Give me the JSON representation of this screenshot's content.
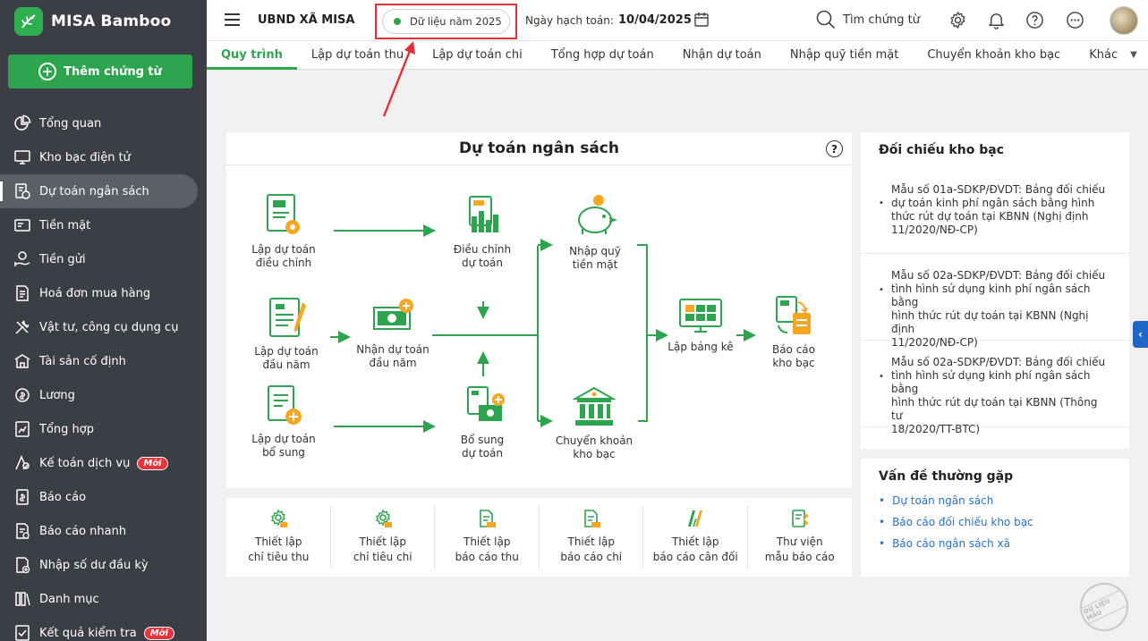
{
  "app": {
    "name": "MISA Bamboo"
  },
  "sidebar": {
    "add_button": "Thêm chứng từ",
    "items": [
      {
        "label": "Tổng quan",
        "icon": "pie-chart-icon"
      },
      {
        "label": "Kho bạc điện tử",
        "icon": "monitor-icon"
      },
      {
        "label": "Dự toán ngân sách",
        "icon": "budget-icon",
        "active": true
      },
      {
        "label": "Tiền mặt",
        "icon": "cash-icon"
      },
      {
        "label": "Tiền gửi",
        "icon": "deposit-icon"
      },
      {
        "label": "Hoá đơn mua hàng",
        "icon": "invoice-icon"
      },
      {
        "label": "Vật tư, công cụ dụng cụ",
        "icon": "tools-icon"
      },
      {
        "label": "Tài sản cố định",
        "icon": "asset-icon"
      },
      {
        "label": "Lương",
        "icon": "salary-icon"
      },
      {
        "label": "Tổng hợp",
        "icon": "summary-icon"
      },
      {
        "label": "Kế toán dịch vụ",
        "icon": "service-icon",
        "badge": "Mới"
      },
      {
        "label": "Báo cáo",
        "icon": "report-icon"
      },
      {
        "label": "Báo cáo nhanh",
        "icon": "quick-report-icon"
      },
      {
        "label": "Nhập số dư đầu kỳ",
        "icon": "opening-balance-icon"
      },
      {
        "label": "Danh mục",
        "icon": "catalog-icon"
      },
      {
        "label": "Kết quả kiểm tra",
        "icon": "check-result-icon",
        "badge": "Mới"
      }
    ]
  },
  "header": {
    "org": "UBND XÃ MISA",
    "year": "Dữ liệu năm 2025",
    "posting_label": "Ngày hạch toán:",
    "posting_date": "10/04/2025",
    "search": "Tìm chứng từ"
  },
  "tabs": [
    {
      "label": "Quy trình",
      "active": true
    },
    {
      "label": "Lập dự toán thu"
    },
    {
      "label": "Lập dự toán chi"
    },
    {
      "label": "Tổng hợp dự toán"
    },
    {
      "label": "Nhận dự toán"
    },
    {
      "label": "Nhập quỹ tiền mặt"
    },
    {
      "label": "Chuyển khoản kho bạc"
    },
    {
      "label": "Khác"
    }
  ],
  "flow": {
    "title": "Dự toán ngân sách",
    "nodes": {
      "adjust_create": [
        "Lập dự toán",
        "điều chỉnh"
      ],
      "adjust": [
        "Điều chỉnh",
        "dự toán"
      ],
      "cash_in": [
        "Nhập quỹ",
        "tiền mặt"
      ],
      "initial_create": [
        "Lập dự toán",
        "đầu năm"
      ],
      "initial_receive": [
        "Nhận dự toán",
        "đầu năm"
      ],
      "statement": [
        "Lập bảng kê"
      ],
      "treasury_report": [
        "Báo cáo",
        "kho bạc"
      ],
      "supplement_create": [
        "Lập dự toán",
        "bổ sung"
      ],
      "supplement": [
        "Bổ sung",
        "dự toán"
      ],
      "transfer": [
        "Chuyển khoản",
        "kho bạc"
      ]
    }
  },
  "tools": [
    [
      "Thiết lập",
      "chỉ tiêu thu"
    ],
    [
      "Thiết lập",
      "chỉ tiêu chi"
    ],
    [
      "Thiết lập",
      "báo cáo thu"
    ],
    [
      "Thiết lập",
      "báo cáo chi"
    ],
    [
      "Thiết lập",
      "báo cáo cân đối"
    ],
    [
      "Thư viện",
      "mẫu báo cáo"
    ]
  ],
  "recon": {
    "title": "Đối chiếu kho bạc",
    "items": [
      [
        "Mẫu số 01a-SDKP/ĐVDT: Bảng đối chiếu",
        "dự toán kinh phí ngân sách bằng hình",
        "thức rút dự toán tại KBNN (Nghị định",
        "11/2020/NĐ-CP)"
      ],
      [
        "Mẫu số 02a-SDKP/ĐVDT: Bảng đối chiếu",
        "tình hình sử dụng kinh phí ngân sách bằng",
        "hình thức rút dự toán tại KBNN (Nghị định",
        "11/2020/NĐ-CP)"
      ],
      [
        "Mẫu số 02a-SDKP/ĐVDT: Bảng đối chiếu",
        "tình hình sử dụng kinh phí ngân sách bằng",
        "hình thức rút dự toán tại KBNN (Thông tư",
        "18/2020/TT-BTC)"
      ]
    ]
  },
  "faq": {
    "title": "Vấn đề thường gặp",
    "items": [
      "Dự toán ngân sách",
      "Báo cáo đối chiếu kho bạc",
      "Báo cáo ngân sách xã"
    ]
  },
  "watermark": "DỮ LIỆU MẪU",
  "colors": {
    "accent": "#2da44e",
    "sidebar": "#3b3f45",
    "highlight": "#e0303a",
    "link": "#2a71c7"
  }
}
